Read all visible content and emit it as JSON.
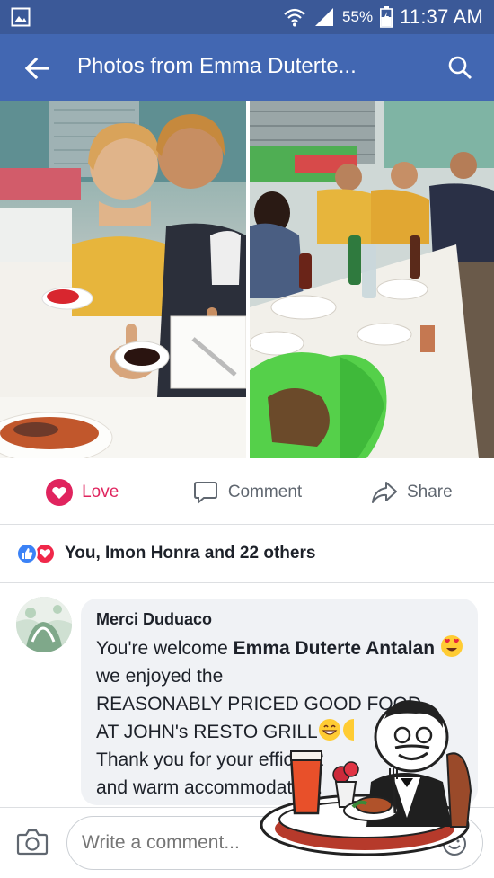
{
  "status_bar": {
    "battery": "55%",
    "time": "11:37 AM",
    "icons": [
      "gallery-icon",
      "wifi-icon",
      "signal-icon",
      "battery-icon"
    ]
  },
  "app_bar": {
    "title": "Photos from Emma Duterte...",
    "icons": [
      "back-arrow-icon",
      "search-icon"
    ]
  },
  "actions": {
    "love": "Love",
    "comment": "Comment",
    "share": "Share",
    "colors": {
      "love": "#e0245e",
      "muted": "#606770"
    }
  },
  "reactions": {
    "summary": "You, Imon Honra and 22 others",
    "icons": [
      "like-icon",
      "love-icon"
    ]
  },
  "comment": {
    "author": "Merci Duduaco",
    "line1": "You're welcome ",
    "name": "Emma Duterte Antalan",
    "line2": " we enjoyed the",
    "line3": "REASONABLY PRICED GOOD FOOD",
    "line4": "AT JOHN's RESTO GRILL",
    "line5": "Thank you for your efficient",
    "line6": "and warm accommodation."
  },
  "write_bar": {
    "placeholder": "Write a comment..."
  },
  "theme": {
    "brand": "#4267b2",
    "status_bar": "#3b5998"
  }
}
